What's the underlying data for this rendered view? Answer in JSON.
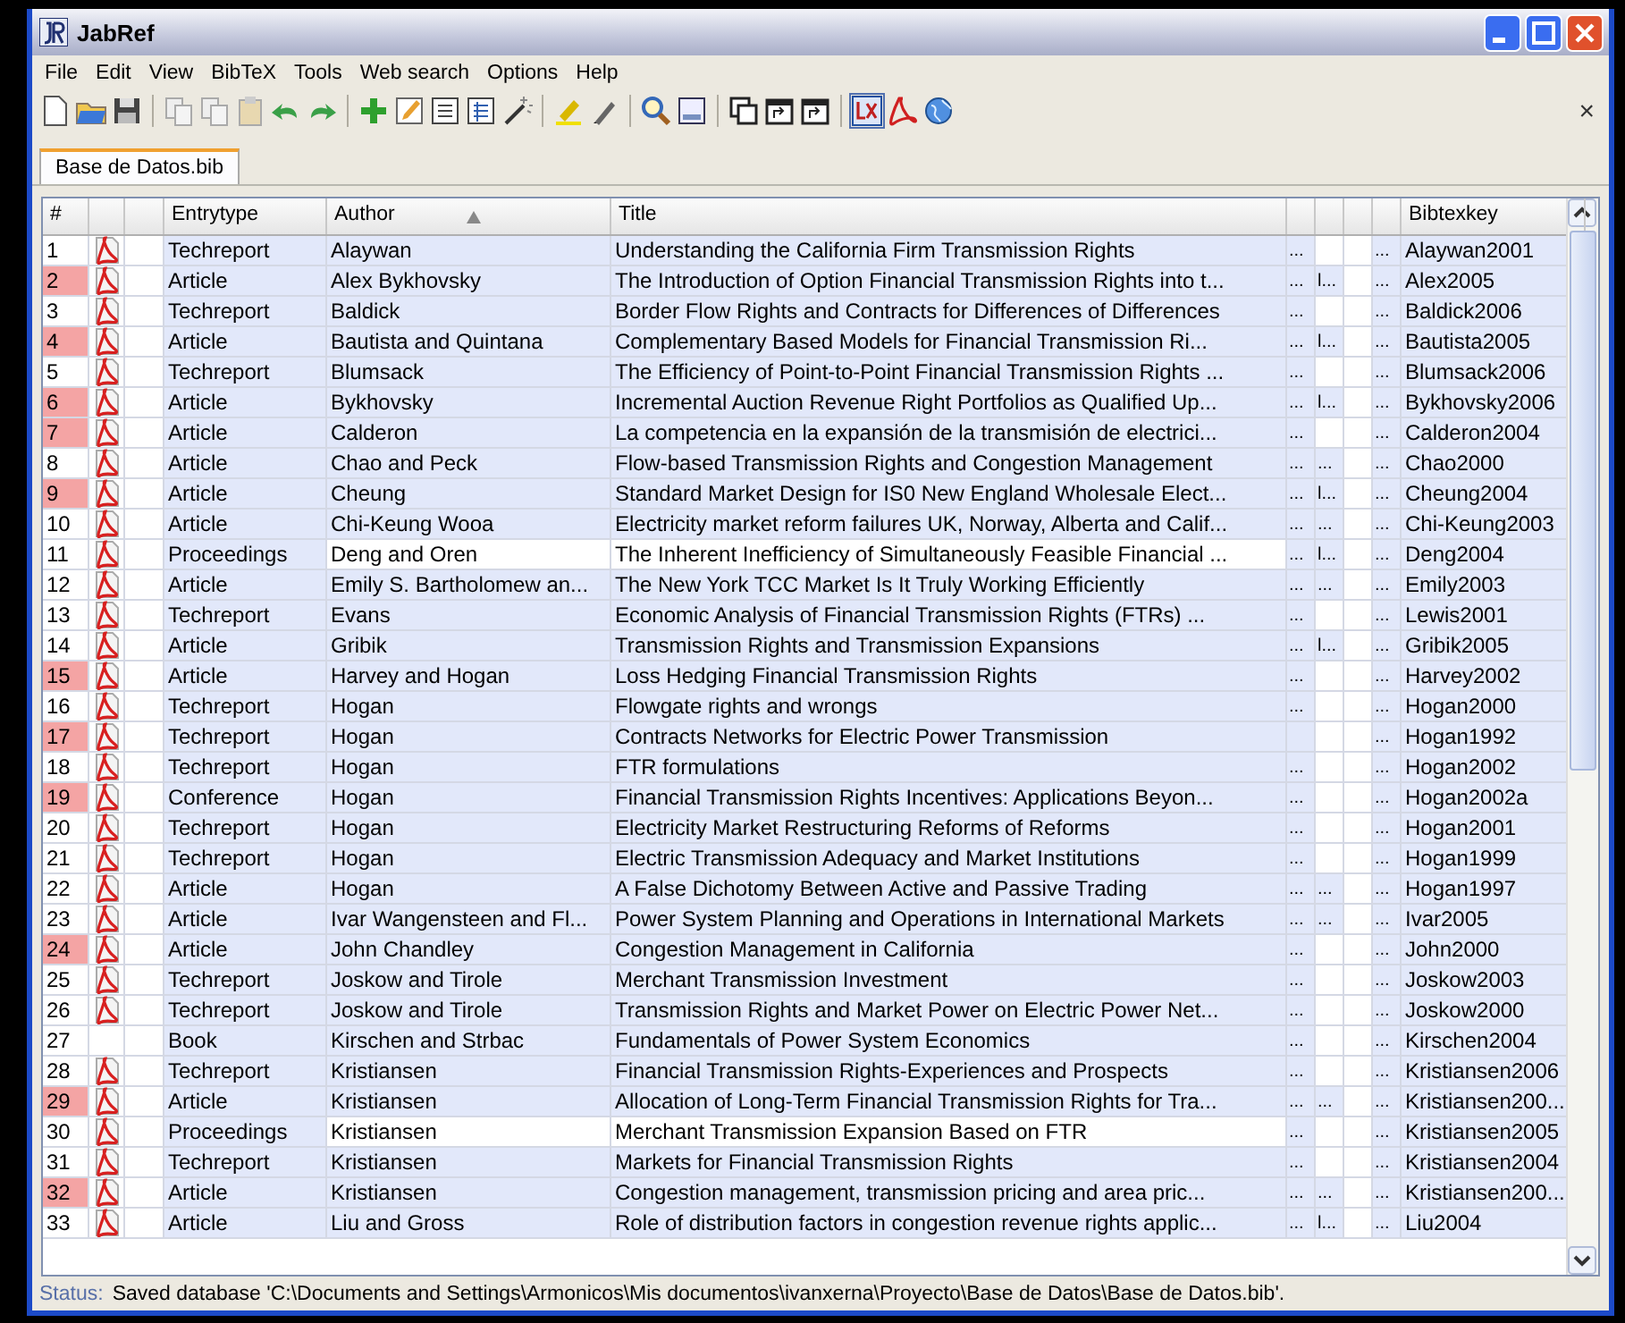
{
  "window": {
    "title": "JabRef"
  },
  "menu": [
    "File",
    "Edit",
    "View",
    "BibTeX",
    "Tools",
    "Web search",
    "Options",
    "Help"
  ],
  "toolbar": {
    "close_glyph": "×"
  },
  "tabs": [
    {
      "label": "Base de Datos.bib",
      "selected": true
    }
  ],
  "table": {
    "columns": {
      "number": "#",
      "entrytype": "Entrytype",
      "author": "Author",
      "title": "Title",
      "bibtexkey": "Bibtexkey"
    },
    "rows": [
      {
        "number": "1",
        "marked": false,
        "has_pdf": true,
        "tinted": true,
        "entrytype": "Techreport",
        "author": "Alaywan",
        "title": "Understanding the California Firm Transmission Rights",
        "column_7": "...",
        "column_8": "",
        "column_10": "...",
        "bibtexkey": "Alaywan2001"
      },
      {
        "number": "2",
        "marked": true,
        "has_pdf": true,
        "tinted": true,
        "entrytype": "Article",
        "author": "Alex Bykhovsky",
        "title": "The Introduction of Option Financial Transmission Rights into t...",
        "column_7": "...",
        "column_8": "l...",
        "column_10": "...",
        "bibtexkey": "Alex2005"
      },
      {
        "number": "3",
        "marked": false,
        "has_pdf": true,
        "tinted": true,
        "entrytype": "Techreport",
        "author": "Baldick",
        "title": "Border Flow Rights and Contracts for Differences of Differences",
        "column_7": "...",
        "column_8": "",
        "column_10": "...",
        "bibtexkey": "Baldick2006"
      },
      {
        "number": "4",
        "marked": true,
        "has_pdf": true,
        "tinted": true,
        "entrytype": "Article",
        "author": "Bautista and Quintana",
        "title": "Complementary Based Models for Financial Transmission Ri...",
        "column_7": "...",
        "column_8": "l...",
        "column_10": "...",
        "bibtexkey": "Bautista2005"
      },
      {
        "number": "5",
        "marked": false,
        "has_pdf": true,
        "tinted": true,
        "entrytype": "Techreport",
        "author": "Blumsack",
        "title": "The Efficiency of Point-to-Point Financial Transmission Rights ...",
        "column_7": "...",
        "column_8": "",
        "column_10": "...",
        "bibtexkey": "Blumsack2006"
      },
      {
        "number": "6",
        "marked": true,
        "has_pdf": true,
        "tinted": true,
        "entrytype": "Article",
        "author": "Bykhovsky",
        "title": "Incremental Auction Revenue Right Portfolios as Qualified Up...",
        "column_7": "...",
        "column_8": "l...",
        "column_10": "...",
        "bibtexkey": "Bykhovsky2006"
      },
      {
        "number": "7",
        "marked": true,
        "has_pdf": true,
        "tinted": true,
        "entrytype": "Article",
        "author": "Calderon",
        "title": "La competencia en la expansión de la transmisión de electrici...",
        "column_7": "...",
        "column_8": "",
        "column_10": "...",
        "bibtexkey": "Calderon2004"
      },
      {
        "number": "8",
        "marked": false,
        "has_pdf": true,
        "tinted": true,
        "entrytype": "Article",
        "author": "Chao and Peck",
        "title": "Flow-based Transmission Rights and Congestion Management",
        "column_7": "...",
        "column_8": "...",
        "column_10": "...",
        "bibtexkey": "Chao2000"
      },
      {
        "number": "9",
        "marked": true,
        "has_pdf": true,
        "tinted": true,
        "entrytype": "Article",
        "author": "Cheung",
        "title": "Standard Market Design for IS0 New England Wholesale Elect...",
        "column_7": "...",
        "column_8": "l...",
        "column_10": "...",
        "bibtexkey": "Cheung2004"
      },
      {
        "number": "10",
        "marked": false,
        "has_pdf": true,
        "tinted": true,
        "entrytype": "Article",
        "author": "Chi-Keung Wooa",
        "title": "Electricity market reform failures UK, Norway, Alberta and Calif...",
        "column_7": "...",
        "column_8": "...",
        "column_10": "...",
        "bibtexkey": "Chi-Keung2003"
      },
      {
        "number": "11",
        "marked": false,
        "has_pdf": true,
        "tinted": false,
        "entrytype": "Proceedings",
        "author": "Deng and Oren",
        "title": "The Inherent Inefficiency of Simultaneously Feasible Financial ...",
        "column_7": "...",
        "column_8": "l...",
        "column_10": "...",
        "bibtexkey": "Deng2004"
      },
      {
        "number": "12",
        "marked": false,
        "has_pdf": true,
        "tinted": true,
        "entrytype": "Article",
        "author": "Emily S. Bartholomew an...",
        "title": "The New York TCC Market Is It Truly Working Efficiently",
        "column_7": "...",
        "column_8": "...",
        "column_10": "...",
        "bibtexkey": "Emily2003"
      },
      {
        "number": "13",
        "marked": false,
        "has_pdf": true,
        "tinted": true,
        "entrytype": "Techreport",
        "author": "Evans",
        "title": "Economic Analysis of Financial Transmission Rights (FTRs) ...",
        "column_7": "...",
        "column_8": "",
        "column_10": "...",
        "bibtexkey": "Lewis2001"
      },
      {
        "number": "14",
        "marked": false,
        "has_pdf": true,
        "tinted": true,
        "entrytype": "Article",
        "author": "Gribik",
        "title": "Transmission Rights and Transmission Expansions",
        "column_7": "...",
        "column_8": "l...",
        "column_10": "...",
        "bibtexkey": "Gribik2005"
      },
      {
        "number": "15",
        "marked": true,
        "has_pdf": true,
        "tinted": true,
        "entrytype": "Article",
        "author": "Harvey and Hogan",
        "title": "Loss Hedging Financial Transmission Rights",
        "column_7": "...",
        "column_8": "",
        "column_10": "...",
        "bibtexkey": "Harvey2002"
      },
      {
        "number": "16",
        "marked": false,
        "has_pdf": true,
        "tinted": true,
        "entrytype": "Techreport",
        "author": "Hogan",
        "title": "Flowgate rights and wrongs",
        "column_7": "...",
        "column_8": "",
        "column_10": "...",
        "bibtexkey": "Hogan2000"
      },
      {
        "number": "17",
        "marked": true,
        "has_pdf": true,
        "tinted": true,
        "entrytype": "Techreport",
        "author": "Hogan",
        "title": "Contracts Networks for Electric Power Transmission",
        "column_7": "",
        "column_8": "",
        "column_10": "...",
        "bibtexkey": "Hogan1992"
      },
      {
        "number": "18",
        "marked": false,
        "has_pdf": true,
        "tinted": true,
        "entrytype": "Techreport",
        "author": "Hogan",
        "title": "FTR formulations",
        "column_7": "...",
        "column_8": "",
        "column_10": "...",
        "bibtexkey": "Hogan2002"
      },
      {
        "number": "19",
        "marked": true,
        "has_pdf": true,
        "tinted": true,
        "entrytype": "Conference",
        "author": "Hogan",
        "title": "Financial Transmission Rights Incentives: Applications Beyon...",
        "column_7": "...",
        "column_8": "",
        "column_10": "...",
        "bibtexkey": "Hogan2002a"
      },
      {
        "number": "20",
        "marked": false,
        "has_pdf": true,
        "tinted": true,
        "entrytype": "Techreport",
        "author": "Hogan",
        "title": "Electricity Market Restructuring Reforms of Reforms",
        "column_7": "...",
        "column_8": "",
        "column_10": "...",
        "bibtexkey": "Hogan2001"
      },
      {
        "number": "21",
        "marked": false,
        "has_pdf": true,
        "tinted": true,
        "entrytype": "Techreport",
        "author": "Hogan",
        "title": "Electric Transmission Adequacy and Market Institutions",
        "column_7": "...",
        "column_8": "",
        "column_10": "...",
        "bibtexkey": "Hogan1999"
      },
      {
        "number": "22",
        "marked": false,
        "has_pdf": true,
        "tinted": true,
        "entrytype": "Article",
        "author": "Hogan",
        "title": "A False Dichotomy Between Active and Passive Trading",
        "column_7": "...",
        "column_8": "...",
        "column_10": "...",
        "bibtexkey": "Hogan1997"
      },
      {
        "number": "23",
        "marked": false,
        "has_pdf": true,
        "tinted": true,
        "entrytype": "Article",
        "author": "Ivar Wangensteen and Fl...",
        "title": "Power System Planning and Operations in International Markets",
        "column_7": "...",
        "column_8": "...",
        "column_10": "...",
        "bibtexkey": "Ivar2005"
      },
      {
        "number": "24",
        "marked": true,
        "has_pdf": true,
        "tinted": true,
        "entrytype": "Article",
        "author": "John Chandley",
        "title": "Congestion Management in California",
        "column_7": "...",
        "column_8": "",
        "column_10": "...",
        "bibtexkey": "John2000"
      },
      {
        "number": "25",
        "marked": false,
        "has_pdf": true,
        "tinted": true,
        "entrytype": "Techreport",
        "author": "Joskow and Tirole",
        "title": "Merchant Transmission Investment",
        "column_7": "...",
        "column_8": "",
        "column_10": "...",
        "bibtexkey": "Joskow2003"
      },
      {
        "number": "26",
        "marked": false,
        "has_pdf": true,
        "tinted": true,
        "entrytype": "Techreport",
        "author": "Joskow and Tirole",
        "title": "Transmission Rights and Market Power on Electric Power Net...",
        "column_7": "...",
        "column_8": "",
        "column_10": "...",
        "bibtexkey": "Joskow2000"
      },
      {
        "number": "27",
        "marked": false,
        "has_pdf": false,
        "tinted": true,
        "entrytype": "Book",
        "author": "Kirschen and Strbac",
        "title": "Fundamentals of Power System Economics",
        "column_7": "...",
        "column_8": "",
        "column_10": "...",
        "bibtexkey": "Kirschen2004"
      },
      {
        "number": "28",
        "marked": false,
        "has_pdf": true,
        "tinted": true,
        "entrytype": "Techreport",
        "author": "Kristiansen",
        "title": "Financial Transmission Rights-Experiences and Prospects",
        "column_7": "...",
        "column_8": "",
        "column_10": "...",
        "bibtexkey": "Kristiansen2006"
      },
      {
        "number": "29",
        "marked": true,
        "has_pdf": true,
        "tinted": true,
        "entrytype": "Article",
        "author": "Kristiansen",
        "title": "Allocation of Long-Term Financial Transmission Rights for Tra...",
        "column_7": "...",
        "column_8": "...",
        "column_10": "...",
        "bibtexkey": "Kristiansen200..."
      },
      {
        "number": "30",
        "marked": false,
        "has_pdf": true,
        "tinted": false,
        "entrytype": "Proceedings",
        "author": "Kristiansen",
        "title": "Merchant Transmission Expansion Based on FTR",
        "column_7": "...",
        "column_8": "",
        "column_10": "...",
        "bibtexkey": "Kristiansen2005"
      },
      {
        "number": "31",
        "marked": false,
        "has_pdf": true,
        "tinted": true,
        "entrytype": "Techreport",
        "author": "Kristiansen",
        "title": "Markets for Financial Transmission Rights",
        "column_7": "...",
        "column_8": "",
        "column_10": "...",
        "bibtexkey": "Kristiansen2004"
      },
      {
        "number": "32",
        "marked": true,
        "has_pdf": true,
        "tinted": true,
        "entrytype": "Article",
        "author": "Kristiansen",
        "title": "Congestion management, transmission pricing and area pric...",
        "column_7": "...",
        "column_8": "...",
        "column_10": "...",
        "bibtexkey": "Kristiansen200..."
      },
      {
        "number": "33",
        "marked": false,
        "has_pdf": true,
        "tinted": true,
        "entrytype": "Article",
        "author": "Liu and Gross",
        "title": "Role of distribution factors in congestion revenue rights applic...",
        "column_7": "...",
        "column_8": "l...",
        "column_10": "...",
        "bibtexkey": "Liu2004"
      }
    ]
  },
  "status_bar": {
    "label": "Status:",
    "text": "Saved database 'C:\\Documents and Settings\\Armonicos\\Mis documentos\\ivanxerna\\Proyecto\\Base de Datos\\Base de Datos.bib'."
  }
}
